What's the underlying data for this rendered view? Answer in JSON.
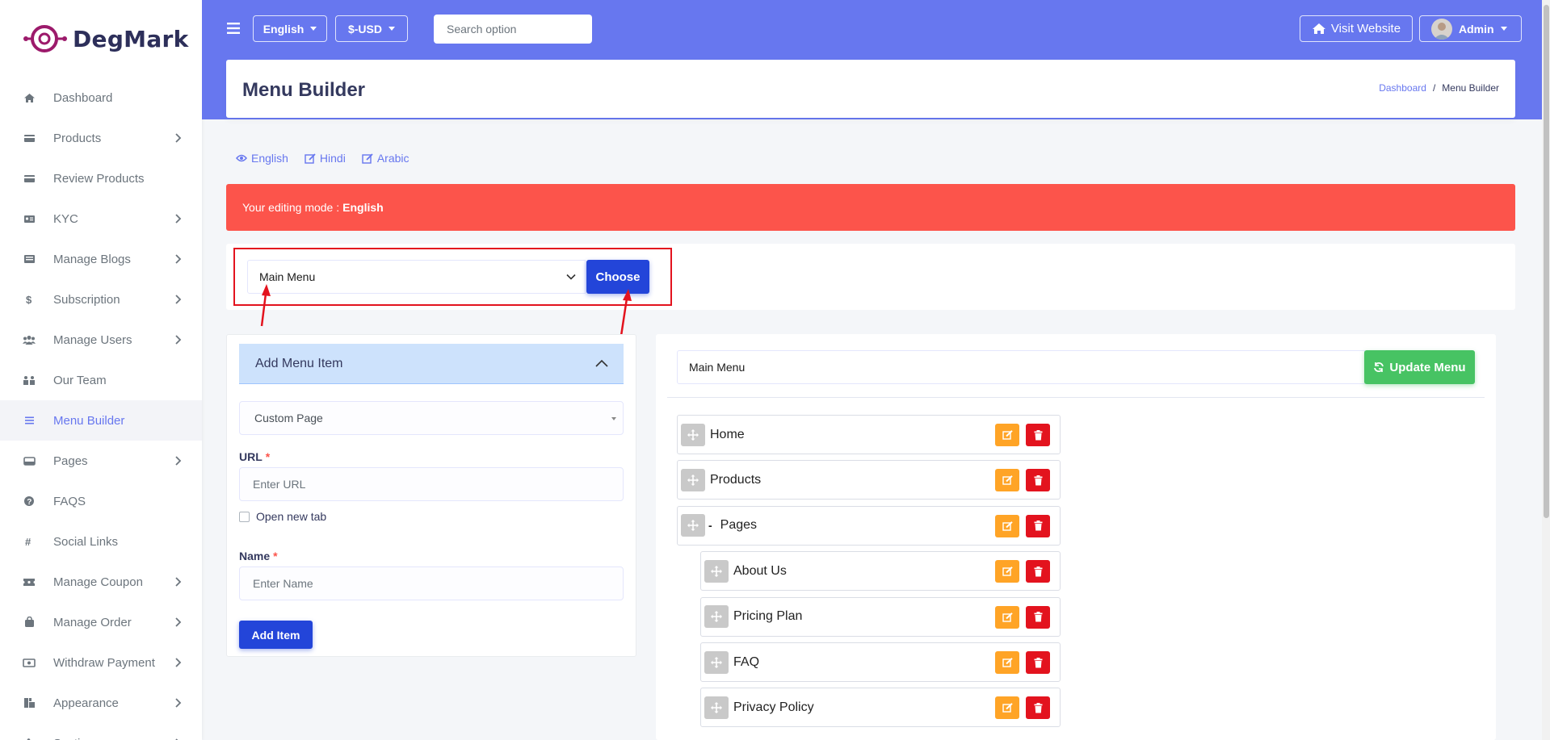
{
  "brand": {
    "name": "DegMark"
  },
  "sidebar": {
    "items": [
      {
        "label": "Dashboard",
        "icon": "home-icon",
        "chevron": false,
        "active": false
      },
      {
        "label": "Products",
        "icon": "card-icon",
        "chevron": true,
        "active": false
      },
      {
        "label": "Review Products",
        "icon": "card-icon",
        "chevron": false,
        "active": false
      },
      {
        "label": "KYC",
        "icon": "id-card-icon",
        "chevron": true,
        "active": false
      },
      {
        "label": "Manage Blogs",
        "icon": "newspaper-icon",
        "chevron": true,
        "active": false
      },
      {
        "label": "Subscription",
        "icon": "dollar-icon",
        "chevron": true,
        "active": false
      },
      {
        "label": "Manage Users",
        "icon": "users-icon",
        "chevron": true,
        "active": false
      },
      {
        "label": "Our Team",
        "icon": "team-icon",
        "chevron": false,
        "active": false
      },
      {
        "label": "Menu Builder",
        "icon": "list-icon",
        "chevron": false,
        "active": true
      },
      {
        "label": "Pages",
        "icon": "page-icon",
        "chevron": true,
        "active": false
      },
      {
        "label": "FAQS",
        "icon": "question-icon",
        "chevron": false,
        "active": false
      },
      {
        "label": "Social Links",
        "icon": "hashtag-icon",
        "chevron": false,
        "active": false
      },
      {
        "label": "Manage Coupon",
        "icon": "ticket-icon",
        "chevron": true,
        "active": false
      },
      {
        "label": "Manage Order",
        "icon": "bag-icon",
        "chevron": true,
        "active": false
      },
      {
        "label": "Withdraw Payment",
        "icon": "money-icon",
        "chevron": true,
        "active": false
      },
      {
        "label": "Appearance",
        "icon": "appearance-icon",
        "chevron": true,
        "active": false
      },
      {
        "label": "Sections",
        "icon": "puzzle-icon",
        "chevron": true,
        "active": false
      }
    ]
  },
  "topbar": {
    "language_label": "English",
    "currency_label": "$-USD",
    "search_placeholder": "Search option",
    "visit_website_label": "Visit Website",
    "admin_label": "Admin"
  },
  "header": {
    "title": "Menu Builder",
    "breadcrumb_home": "Dashboard",
    "breadcrumb_sep": "/",
    "breadcrumb_current": "Menu Builder"
  },
  "languages": {
    "english": "English",
    "hindi": "Hindi",
    "arabic": "Arabic"
  },
  "alert": {
    "prefix": "Your editing mode :",
    "mode": "English"
  },
  "menu_selector": {
    "selected": "Main Menu",
    "choose_label": "Choose"
  },
  "add_form": {
    "title": "Add Menu Item",
    "type_selected": "Custom Page",
    "url_label": "URL",
    "url_placeholder": "Enter URL",
    "new_tab_label": "Open new tab",
    "name_label": "Name",
    "name_placeholder": "Enter Name",
    "required_mark": "*",
    "add_button": "Add Item"
  },
  "menu_structure": {
    "menu_name": "Main Menu",
    "update_label": "Update Menu",
    "items": [
      {
        "label": "Home",
        "level": 0
      },
      {
        "label": "Products",
        "level": 0
      },
      {
        "label": "Pages",
        "level": 0,
        "collapse": "-"
      },
      {
        "label": "About Us",
        "level": 1
      },
      {
        "label": "Pricing Plan",
        "level": 1
      },
      {
        "label": "FAQ",
        "level": 1
      },
      {
        "label": "Privacy Policy",
        "level": 1
      }
    ]
  },
  "colors": {
    "primary": "#6777ef",
    "choose_button": "#2345d9",
    "alert": "#fc544b",
    "update_button": "#47c363",
    "edit_button": "#ffa426",
    "delete_button": "#e3131e",
    "annotation": "#e3131e"
  }
}
